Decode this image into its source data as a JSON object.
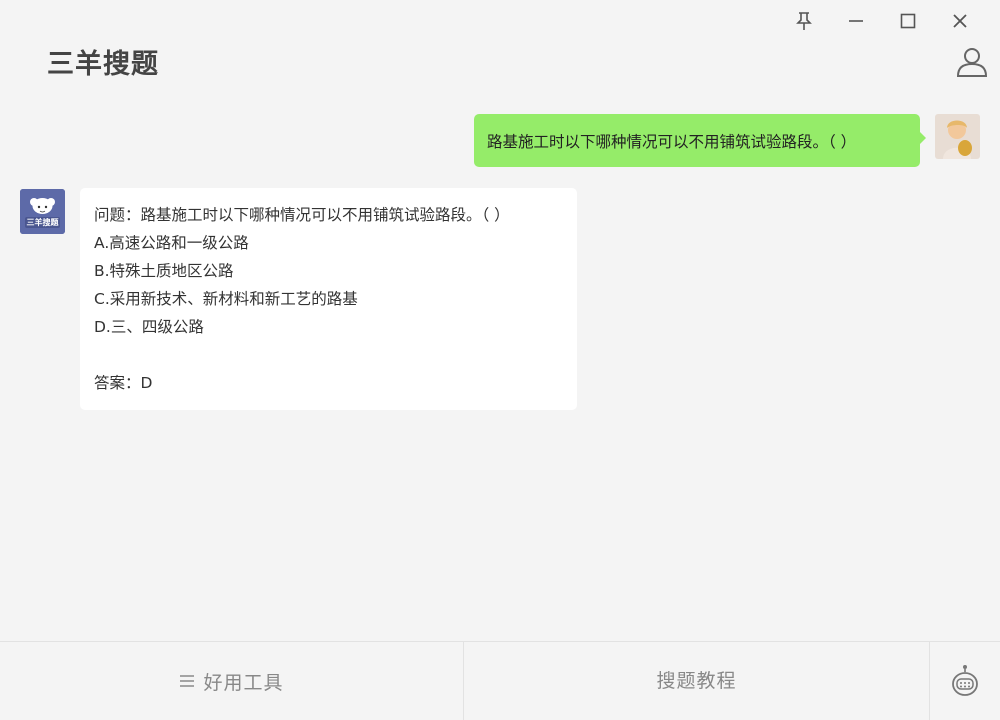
{
  "window": {
    "title": "三羊搜题",
    "controls": [
      "pin-icon",
      "minimize-icon",
      "maximize-icon",
      "close-icon"
    ]
  },
  "chat": {
    "user_message": "路基施工时以下哪种情况可以不用铺筑试验路段。（  ）",
    "bot_avatar_label": "三羊搜题",
    "bot_reply": {
      "question": "问题：路基施工时以下哪种情况可以不用铺筑试验路段。（  ）",
      "options": [
        "A.高速公路和一级公路",
        "B.特殊土质地区公路",
        "C.采用新技术、新材料和新工艺的路基",
        "D.三、四级公路"
      ],
      "answer": "答案：D"
    }
  },
  "footer": {
    "tools_label": "好用工具",
    "tutorial_label": "搜题教程"
  },
  "colors": {
    "background": "#f4f4f4",
    "user_bubble": "#95ec69",
    "bot_bubble": "#ffffff",
    "bot_avatar": "#5d6aa8"
  }
}
